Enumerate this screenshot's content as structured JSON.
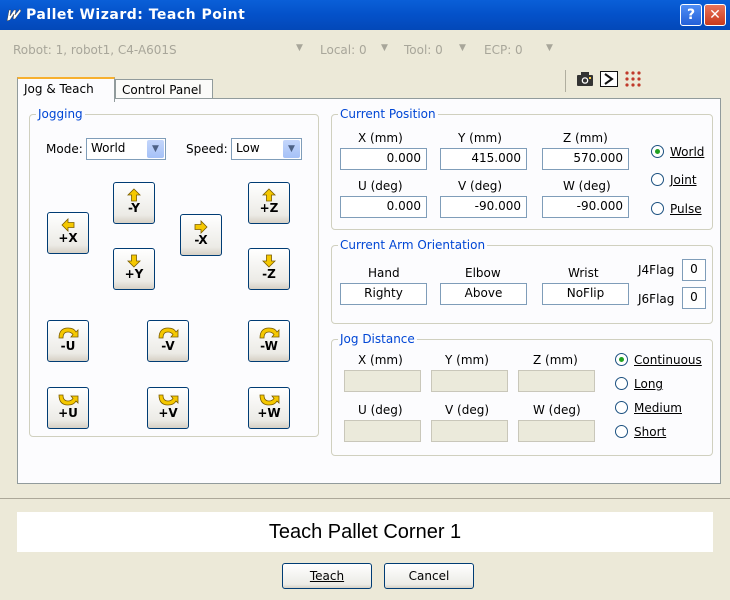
{
  "window": {
    "title": "Pallet Wizard: Teach Point",
    "help_label": "?",
    "close_label": "✕"
  },
  "toolbar": {
    "robot": "Robot: 1, robot1, C4-A601S",
    "local": "Local: 0",
    "tool": "Tool: 0",
    "ecp": "ECP: 0",
    "dropdown_glyph": "▼"
  },
  "tabs": [
    {
      "label": "Jog & Teach"
    },
    {
      "label": "Control Panel"
    }
  ],
  "jogging": {
    "legend": "Jogging",
    "mode_label": "Mode:",
    "mode_value": "World",
    "speed_label": "Speed:",
    "speed_value": "Low",
    "buttons": {
      "minus_y": "-Y",
      "plus_x": "+X",
      "plus_y": "+Y",
      "minus_x": "-X",
      "plus_z": "+Z",
      "minus_z": "-Z",
      "minus_u": "-U",
      "minus_v": "-V",
      "minus_w": "-W",
      "plus_u": "+U",
      "plus_v": "+V",
      "plus_w": "+W"
    }
  },
  "current_position": {
    "legend": "Current Position",
    "headers": [
      "X (mm)",
      "Y (mm)",
      "Z (mm)",
      "U (deg)",
      "V (deg)",
      "W (deg)"
    ],
    "values": [
      "0.000",
      "415.000",
      "570.000",
      "0.000",
      "-90.000",
      "-90.000"
    ],
    "modes": [
      "World",
      "Joint",
      "Pulse"
    ],
    "selected_mode": "World"
  },
  "arm_orientation": {
    "legend": "Current Arm Orientation",
    "headers": [
      "Hand",
      "Elbow",
      "Wrist"
    ],
    "values": [
      "Righty",
      "Above",
      "NoFlip"
    ],
    "j4flag_label": "J4Flag",
    "j4flag_value": "0",
    "j6flag_label": "J6Flag",
    "j6flag_value": "0"
  },
  "jog_distance": {
    "legend": "Jog Distance",
    "headers": [
      "X (mm)",
      "Y (mm)",
      "Z (mm)",
      "U (deg)",
      "V (deg)",
      "W (deg)"
    ],
    "options": [
      "Continuous",
      "Long",
      "Medium",
      "Short"
    ],
    "selected": "Continuous"
  },
  "message": "Teach Pallet Corner 1",
  "footer": {
    "teach_label": "Teach",
    "cancel_label": "Cancel"
  },
  "colors": {
    "legend": "#0046d5",
    "titlebar": "#0451c9",
    "arrow_fill": "#f5c800"
  }
}
